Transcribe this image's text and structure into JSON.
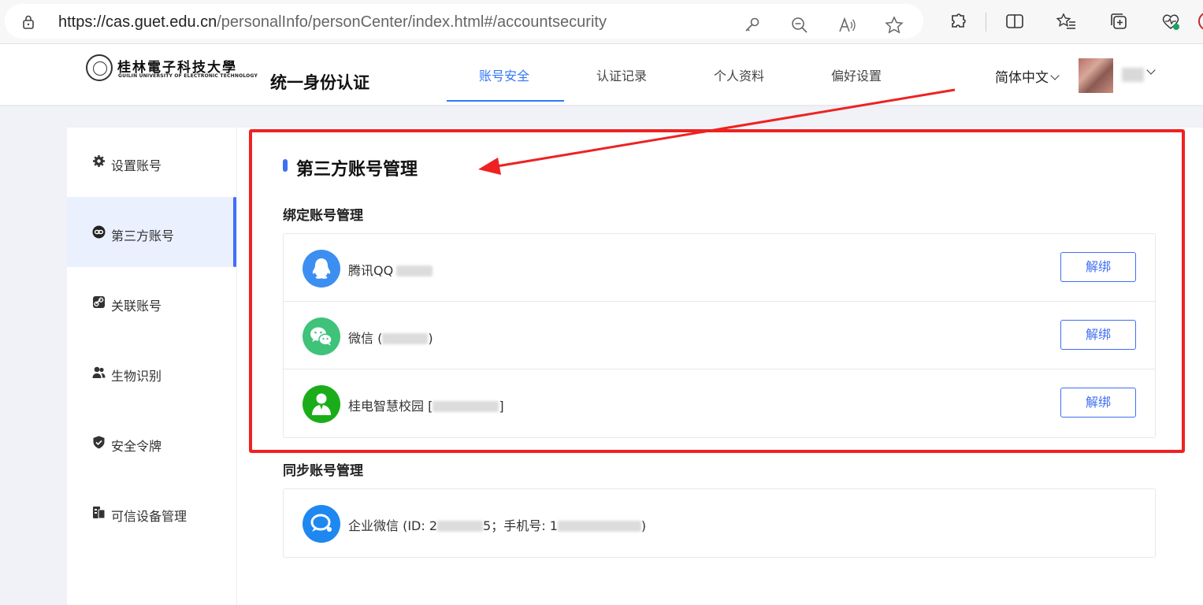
{
  "browser": {
    "url_host": "https://cas.guet.edu.cn",
    "url_path": "/personalInfo/personCenter/index.html#/accountsecurity"
  },
  "header": {
    "logo_cn": "桂林電子科技大學",
    "logo_en": "GUILIN UNIVERSITY OF ELECTRONIC TECHNOLOGY",
    "app_title": "统一身份认证",
    "tabs": [
      {
        "label": "账号安全",
        "active": true
      },
      {
        "label": "认证记录",
        "active": false
      },
      {
        "label": "个人资料",
        "active": false
      },
      {
        "label": "偏好设置",
        "active": false
      }
    ],
    "language": "简体中文"
  },
  "sidebar": {
    "items": [
      {
        "label": "设置账号",
        "icon": "gear-icon",
        "active": false
      },
      {
        "label": "第三方账号",
        "icon": "link-icon",
        "active": true
      },
      {
        "label": "关联账号",
        "icon": "chain-icon",
        "active": false
      },
      {
        "label": "生物识别",
        "icon": "users-icon",
        "active": false
      },
      {
        "label": "安全令牌",
        "icon": "shield-icon",
        "active": false
      },
      {
        "label": "可信设备管理",
        "icon": "device-icon",
        "active": false
      }
    ]
  },
  "main": {
    "section_title": "第三方账号管理",
    "bind_title": "绑定账号管理",
    "bound_accounts": [
      {
        "name": "腾讯QQ",
        "icon": "qq-icon",
        "suffix": "",
        "action": "解绑",
        "color": "#3c8ff0"
      },
      {
        "name": "微信 (",
        "icon": "wechat-icon",
        "suffix": ")",
        "action": "解绑",
        "color": "#3fc27a"
      },
      {
        "name": "桂电智慧校园 [",
        "icon": "campus-icon",
        "suffix": "]",
        "action": "解绑",
        "color": "#1aad19"
      }
    ],
    "sync_title": "同步账号管理",
    "sync_accounts": [
      {
        "name_prefix": "企业微信 (ID: 2",
        "name_mid": "5；手机号: 1",
        "name_suffix": ")",
        "icon": "work-wechat-icon",
        "color": "#1e88f0"
      }
    ]
  },
  "colors": {
    "accent": "#3f6ff3",
    "annotation": "#ee2222"
  }
}
